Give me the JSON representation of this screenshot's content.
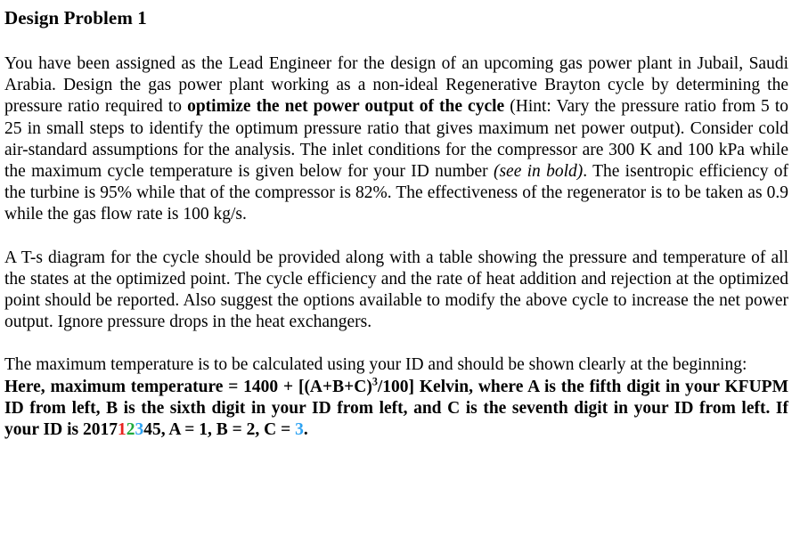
{
  "document": {
    "title": "Design Problem 1",
    "paragraph1": {
      "part1": "You have been assigned as the Lead Engineer for the design of an upcoming gas power plant in Jubail, Saudi Arabia. Design the gas power plant working as a non-ideal Regenerative Brayton cycle by determining the pressure ratio required to ",
      "bold1": "optimize the net power output of the cycle",
      "part2": " (Hint: Vary the pressure ratio from 5 to 25 in small steps to identify the optimum pressure ratio that gives maximum net power output). Consider cold air-standard assumptions for the analysis. The inlet conditions for the compressor are 300 K and 100 kPa while the maximum cycle temperature is given below for your ID number ",
      "italic1": "(see in bold)",
      "part3": ". The isentropic efficiency of the turbine is 95% while that of the compressor is 82%. The effectiveness of the regenerator is to be taken as 0.9 while the gas flow rate is 100 kg/s."
    },
    "paragraph2": {
      "text": "A T-s diagram for the cycle should be provided along with a table showing the pressure and temperature of all the states at the optimized point. The cycle efficiency and the rate of heat addition and rejection at the optimized point should be reported. Also suggest the options available to modify the above cycle to increase the net power output. Ignore pressure drops in the heat exchangers."
    },
    "paragraph3": {
      "intro": "The maximum temperature is to be calculated using your ID and should be shown clearly at the beginning:",
      "formula_part1": "Here, maximum temperature = 1400 + [(A+B+C)",
      "formula_exponent": "3",
      "formula_part2": "/100] Kelvin, where A is the fifth digit in your KFUPM ID from left, B is the sixth digit in your ID from left, and C is the seventh digit in your ID from left. If your ID is 2017",
      "id_digit_a": "1",
      "id_digit_b": "2",
      "id_digit_c": "3",
      "id_tail": "45, A = 1, B = 2, C = ",
      "answer_c": "3",
      "period": "."
    }
  },
  "colors": {
    "digit_a": "#e8231f",
    "digit_b": "#1faa3c",
    "digit_c": "#2ea3f2",
    "text": "#000000",
    "background": "#ffffff"
  }
}
